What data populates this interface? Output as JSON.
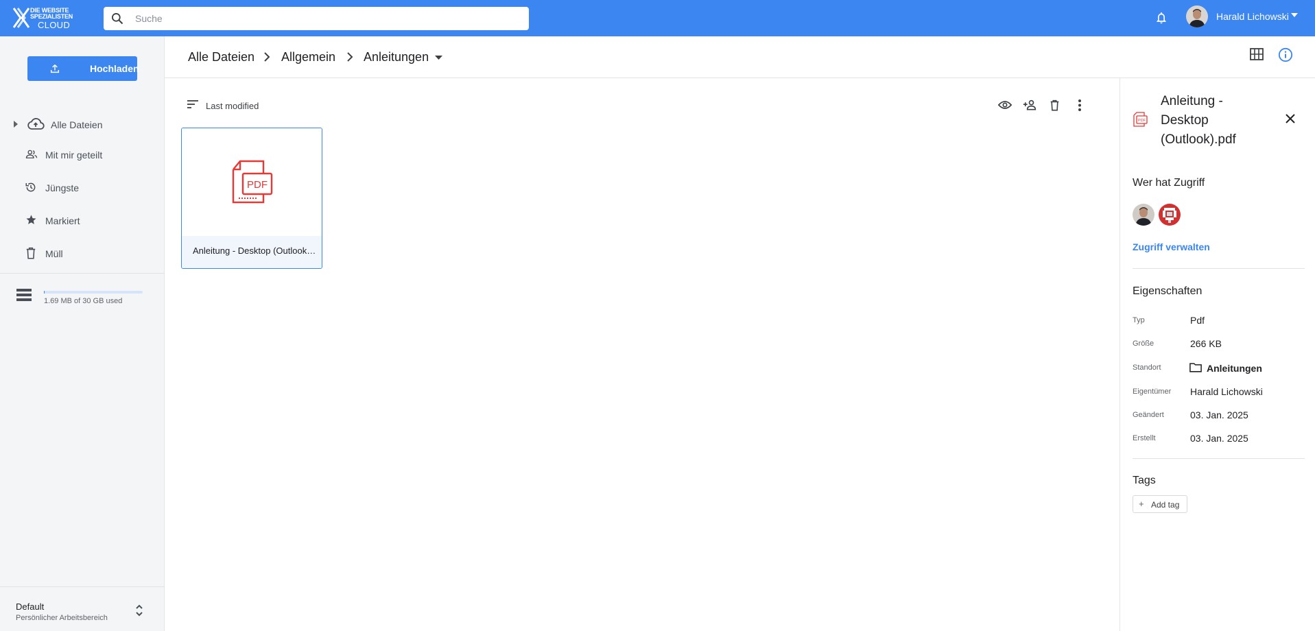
{
  "brand": {
    "line1": "DIE WEBSITE",
    "line2": "SPEZIALISTEN",
    "line3": "CLOUD"
  },
  "search": {
    "placeholder": "Suche"
  },
  "user": {
    "name": "Harald Lichowski"
  },
  "sidebar": {
    "upload_label": "Hochladen",
    "items": [
      {
        "label": "Alle Dateien",
        "icon": "cloud-upload-icon"
      },
      {
        "label": "Mit mir geteilt",
        "icon": "people-icon"
      },
      {
        "label": "Jüngste",
        "icon": "history-icon"
      },
      {
        "label": "Markiert",
        "icon": "star-icon"
      },
      {
        "label": "Müll",
        "icon": "trash-icon"
      }
    ],
    "storage": {
      "text": "1.69 MB of 30 GB used",
      "used_fraction": 0.0001
    },
    "workspace": {
      "name": "Default",
      "subtitle": "Persönlicher Arbeitsbereich"
    }
  },
  "breadcrumb": [
    "Alle Dateien",
    "Allgemein",
    "Anleitungen"
  ],
  "toolbar": {
    "sort_label": "Last modified"
  },
  "files": [
    {
      "name": "Anleitung - Desktop (Outlook).pdf",
      "type_label": "PDF"
    }
  ],
  "details": {
    "title": "Anleitung - Desktop (Outlook).pdf",
    "access_title": "Wer hat Zugriff",
    "manage_access": "Zugriff verwalten",
    "properties_title": "Eigenschaften",
    "properties": [
      {
        "key": "Typ",
        "value": "Pdf"
      },
      {
        "key": "Größe",
        "value": "266 KB"
      },
      {
        "key": "Standort",
        "value": "Anleitungen"
      },
      {
        "key": "Eigentümer",
        "value": "Harald Lichowski"
      },
      {
        "key": "Geändert",
        "value": "03. Jan. 2025"
      },
      {
        "key": "Erstellt",
        "value": "03. Jan. 2025"
      }
    ],
    "tags_title": "Tags",
    "add_tag": "Add tag"
  },
  "colors": {
    "accent": "#3b86f0",
    "pdf_red": "#e53935",
    "sidebar_bg": "#f4f5f7"
  }
}
